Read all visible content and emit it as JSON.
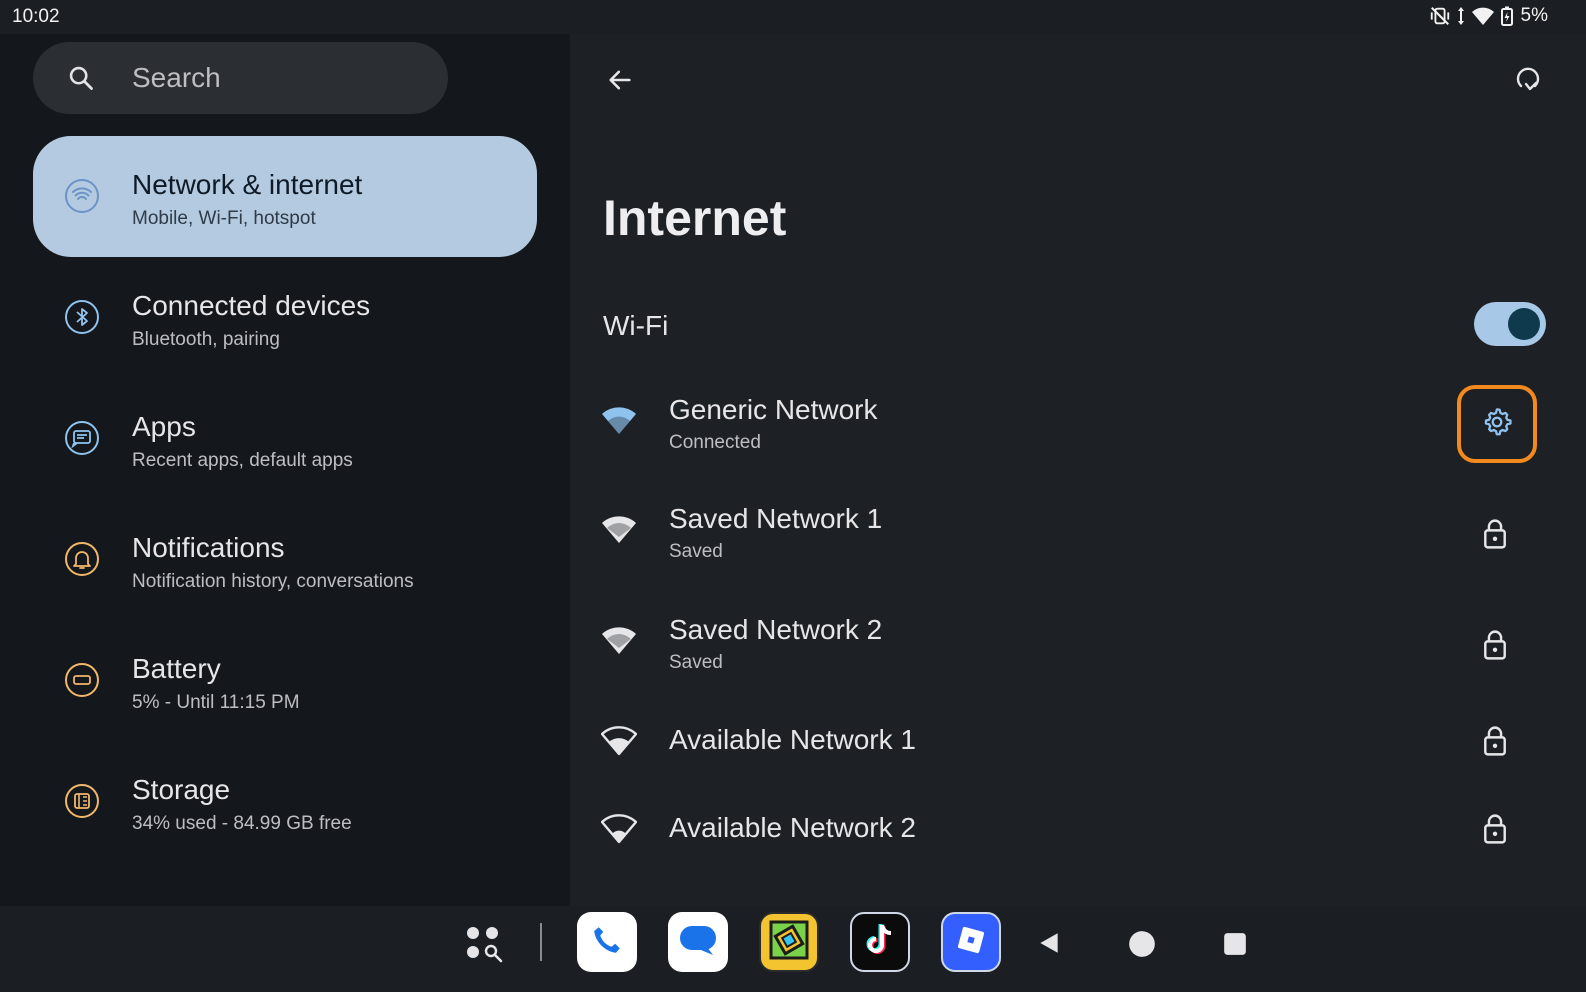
{
  "status_bar": {
    "time": "10:02",
    "battery_percent": "5%",
    "icons": [
      "vibrate-off-icon",
      "data-arrows-icon",
      "wifi-icon",
      "battery-icon"
    ]
  },
  "search": {
    "placeholder": "Search",
    "value": ""
  },
  "sidebar": {
    "items": [
      {
        "title": "Network & internet",
        "subtitle": "Mobile, Wi-Fi, hotspot",
        "icon": "wifi-icon",
        "active": true
      },
      {
        "title": "Connected devices",
        "subtitle": "Bluetooth, pairing",
        "icon": "bluetooth-icon",
        "active": false
      },
      {
        "title": "Apps",
        "subtitle": "Recent apps, default apps",
        "icon": "apps-icon",
        "active": false
      },
      {
        "title": "Notifications",
        "subtitle": "Notification history, conversations",
        "icon": "bell-icon",
        "active": false
      },
      {
        "title": "Battery",
        "subtitle": "5% - Until 11:15 PM",
        "icon": "battery-icon",
        "active": false
      },
      {
        "title": "Storage",
        "subtitle": "34% used - 84.99 GB free",
        "icon": "storage-icon",
        "active": false
      }
    ]
  },
  "main": {
    "title": "Internet",
    "wifi_label": "Wi-Fi",
    "wifi_enabled": true,
    "networks": [
      {
        "name": "Generic Network",
        "status": "Connected",
        "trailing": "gear-icon",
        "connected": true
      },
      {
        "name": "Saved Network 1",
        "status": "Saved",
        "trailing": "lock-icon",
        "connected": false
      },
      {
        "name": "Saved Network 2",
        "status": "Saved",
        "trailing": "lock-icon",
        "connected": false
      },
      {
        "name": "Available Network 1",
        "status": "",
        "trailing": "lock-icon",
        "connected": false
      },
      {
        "name": "Available Network 2",
        "status": "",
        "trailing": "lock-icon",
        "connected": false
      }
    ]
  },
  "taskbar": {
    "apps": [
      "app-drawer-icon",
      "phone-icon",
      "messages-icon",
      "geometry-dash-icon",
      "tiktok-icon",
      "roblox-icon"
    ],
    "nav": [
      "back-icon",
      "home-icon",
      "recents-icon"
    ]
  },
  "colors": {
    "active_nav_bg": "#b3cae0",
    "accent_blue": "#8fc3ee",
    "highlight_orange": "#f28a1e",
    "toggle_track": "#a7c8e6"
  }
}
